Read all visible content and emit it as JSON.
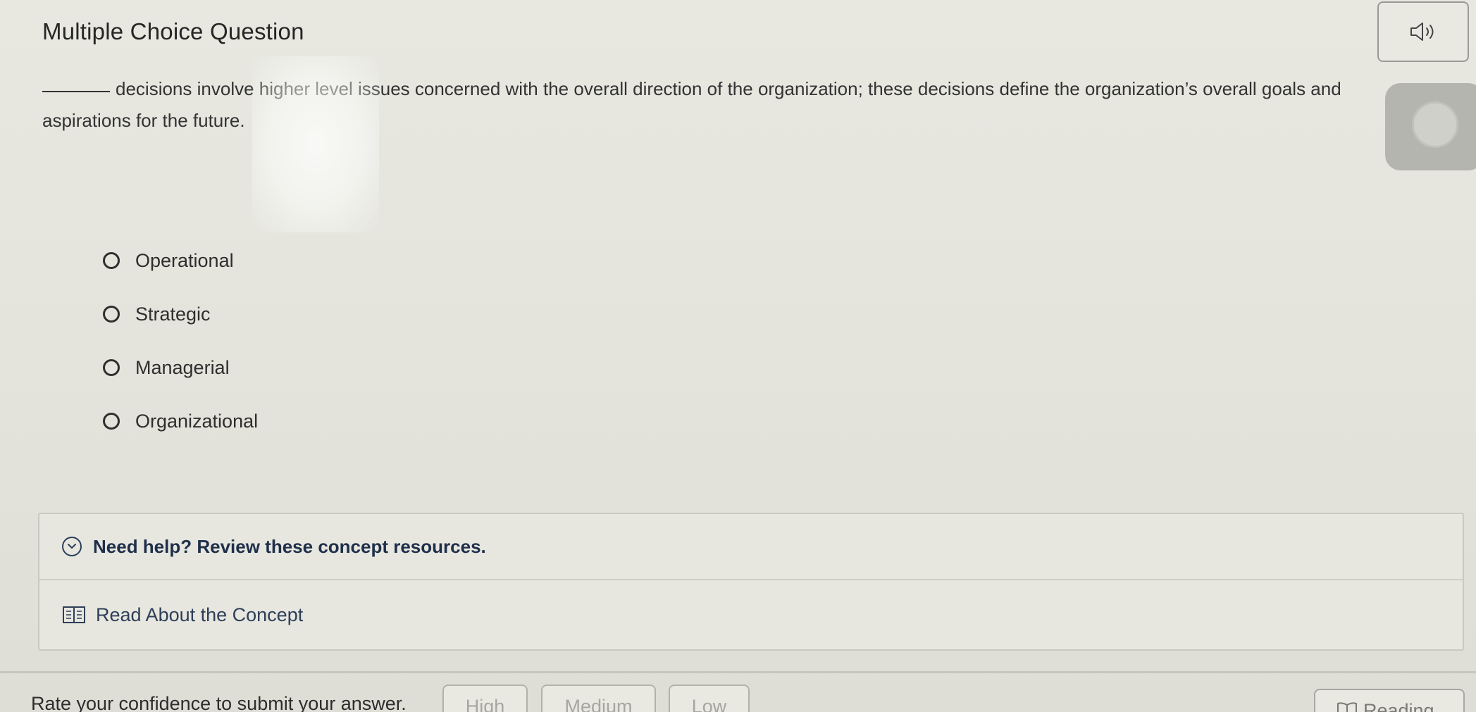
{
  "question": {
    "type_title": "Multiple Choice Question",
    "prompt_text": "decisions involve higher level issues concerned with the overall direction of the organization; these decisions define the organization’s overall goals and aspirations for the future."
  },
  "options": [
    {
      "label": "Operational"
    },
    {
      "label": "Strategic"
    },
    {
      "label": "Managerial"
    },
    {
      "label": "Organizational"
    }
  ],
  "help": {
    "title": "Need help? Review these concept resources.",
    "link_label": "Read About the Concept"
  },
  "confidence": {
    "label": "Rate your confidence to submit your answer.",
    "high": "High",
    "medium": "Medium",
    "low": "Low"
  },
  "footer": {
    "reading_label": "Reading"
  },
  "icons": {
    "audio": "speaker-icon",
    "help_toggle": "chevron-down-icon",
    "concept": "book-icon",
    "reading": "book-open-icon"
  }
}
